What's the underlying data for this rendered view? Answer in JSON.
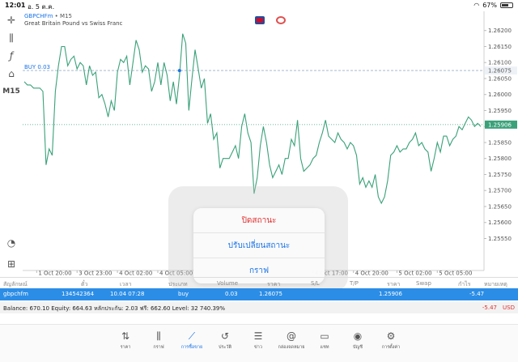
{
  "status": {
    "time": "12:01",
    "date": "อ. 5 ต.ค.",
    "battery": "67%",
    "battery_level": 0.67
  },
  "left_toolbar": {
    "timeframe": "M15"
  },
  "symbol": {
    "name": "GBPCHFm",
    "separator": " • ",
    "timeframe": "M15",
    "description": "Great Britain Pound vs Swiss Franc"
  },
  "chart_data": {
    "type": "line",
    "color": "#3aa17a",
    "ylim": [
      1.2545,
      1.2626
    ],
    "y_ticks": [
      "1.26200",
      "1.26150",
      "1.26100",
      "1.26050",
      "1.26000",
      "1.25950",
      "1.25900",
      "1.25850",
      "1.25800",
      "1.25750",
      "1.25700",
      "1.25650",
      "1.25600",
      "1.25550"
    ],
    "y_tick_values": [
      1.262,
      1.2615,
      1.261,
      1.2605,
      1.26,
      1.2595,
      1.259,
      1.2585,
      1.258,
      1.2575,
      1.257,
      1.2565,
      1.256,
      1.2555
    ],
    "x_ticks": [
      "1 Oct 20:00",
      "3 Oct 23:00",
      "4 Oct 02:00",
      "4 Oct 05:00",
      "4 Oct 17:00",
      "4 Oct 20:00",
      "5 Oct 02:00",
      "5 Oct 05:00"
    ],
    "x_tick_index": [
      4,
      17,
      30,
      43,
      93,
      106,
      120,
      133
    ],
    "buy_line": {
      "label": "BUY 0.03",
      "price": 1.26075,
      "price_label": "1.26075"
    },
    "current_price": {
      "price": 1.25906,
      "price_label": "1.25906"
    },
    "series": [
      {
        "values": [
          1.2604,
          1.2603,
          1.2603,
          1.2602,
          1.2602,
          1.2602,
          1.2601,
          1.2578,
          1.2583,
          1.2581,
          1.2601,
          1.2609,
          1.2615,
          1.2615,
          1.2609,
          1.2611,
          1.2612,
          1.2608,
          1.261,
          1.2609,
          1.2603,
          1.2609,
          1.2606,
          1.2607,
          1.2599,
          1.26,
          1.2597,
          1.2593,
          1.2598,
          1.2595,
          1.2607,
          1.2611,
          1.261,
          1.2612,
          1.2603,
          1.261,
          1.2617,
          1.2614,
          1.2607,
          1.2609,
          1.2608,
          1.2601,
          1.2604,
          1.261,
          1.2603,
          1.261,
          1.2606,
          1.2598,
          1.2604,
          1.2597,
          1.2606,
          1.2619,
          1.2616,
          1.2595,
          1.2605,
          1.2614,
          1.2608,
          1.2602,
          1.2605,
          1.2591,
          1.2594,
          1.2586,
          1.2588,
          1.2577,
          1.258,
          1.258,
          1.258,
          1.2582,
          1.2584,
          1.258,
          1.259,
          1.2594,
          1.2588,
          1.2585,
          1.2569,
          1.2574,
          1.2584,
          1.259,
          1.2585,
          1.2578,
          1.2574,
          1.2576,
          1.2578,
          1.2575,
          1.258,
          1.258,
          1.2586,
          1.2584,
          1.2592,
          1.258,
          1.2576,
          1.2577,
          1.2578,
          1.258,
          1.2581,
          1.2585,
          1.2588,
          1.2592,
          1.2587,
          1.2586,
          1.2585,
          1.2588,
          1.2586,
          1.2585,
          1.2583,
          1.2585,
          1.2584,
          1.2581,
          1.2572,
          1.2574,
          1.2571,
          1.2573,
          1.2571,
          1.2575,
          1.2568,
          1.2566,
          1.2568,
          1.2573,
          1.2581,
          1.2582,
          1.2584,
          1.2582,
          1.2583,
          1.2583,
          1.2585,
          1.2586,
          1.2588,
          1.2584,
          1.2585,
          1.2583,
          1.2582,
          1.2576,
          1.258,
          1.2585,
          1.2582,
          1.2587,
          1.2587,
          1.2584,
          1.2586,
          1.2587,
          1.259,
          1.2589,
          1.2591,
          1.2593,
          1.2592,
          1.259,
          1.2591,
          1.259
        ]
      }
    ]
  },
  "popup": {
    "items": [
      "ปิดสถานะ",
      "ปรับเปลี่ยนสถานะ",
      "กราฟ"
    ]
  },
  "trade_table": {
    "headers": [
      "สัญลักษณ์",
      "ตั๋ว",
      "เวลา",
      "ประเภท",
      "Volume",
      "ราคา",
      "S/L",
      "T/P",
      "ราคา",
      "Swap",
      "กำไร",
      "หมายเหตุ"
    ],
    "row": [
      "gbpchfm",
      "134542364",
      "10.04 07:28",
      "buy",
      "0.03",
      "1.26075",
      "",
      "",
      "1.25906",
      "",
      "-5.47",
      ""
    ]
  },
  "balance": {
    "text": "Balance: 670.10 Equity: 664.63 หลักประกัน: 2.03 ฟรี: 662.60 Level: 32 740.39%",
    "pl": "-5.47",
    "currency": "USD"
  },
  "tabbar": {
    "items": [
      {
        "label": "ราคา",
        "icon": "quotes-icon"
      },
      {
        "label": "กราฟ",
        "icon": "candles-icon"
      },
      {
        "label": "การซื้อขาย",
        "icon": "trade-icon"
      },
      {
        "label": "ประวัติ",
        "icon": "history-icon"
      },
      {
        "label": "ข่าว",
        "icon": "news-icon"
      },
      {
        "label": "กล่องจดหมาย",
        "icon": "mailbox-icon"
      },
      {
        "label": "แชท",
        "icon": "chat-icon"
      },
      {
        "label": "บัญชี",
        "icon": "account-icon"
      },
      {
        "label": "การตั้งค่า",
        "icon": "settings-icon"
      }
    ],
    "active_index": 2
  }
}
